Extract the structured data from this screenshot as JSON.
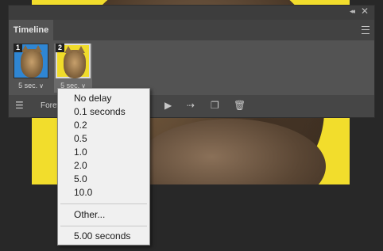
{
  "panel": {
    "tab_title": "Timeline",
    "collapse_glyph": "◂◂",
    "close_glyph": "✕"
  },
  "frames": [
    {
      "number": "1",
      "delay": "5 sec.",
      "thumb_color": "#2f86d3"
    },
    {
      "number": "2",
      "delay": "5 sec.",
      "thumb_color": "#f0dc2a"
    }
  ],
  "controls": {
    "loop_label": "Forever",
    "icons": [
      "frame-animation-settings-icon",
      "play-icon",
      "tween-icon",
      "duplicate-frame-icon",
      "delete-frame-icon"
    ]
  },
  "delay_menu": {
    "items": [
      "No delay",
      "0.1 seconds",
      "0.2",
      "0.5",
      "1.0",
      "2.0",
      "5.0",
      "10.0"
    ],
    "other": "Other...",
    "current": "5.00 seconds"
  },
  "colors": {
    "canvas_bg": "#f2dd2c",
    "panel_bg": "#535353",
    "menu_bg": "#f0f0f0"
  }
}
